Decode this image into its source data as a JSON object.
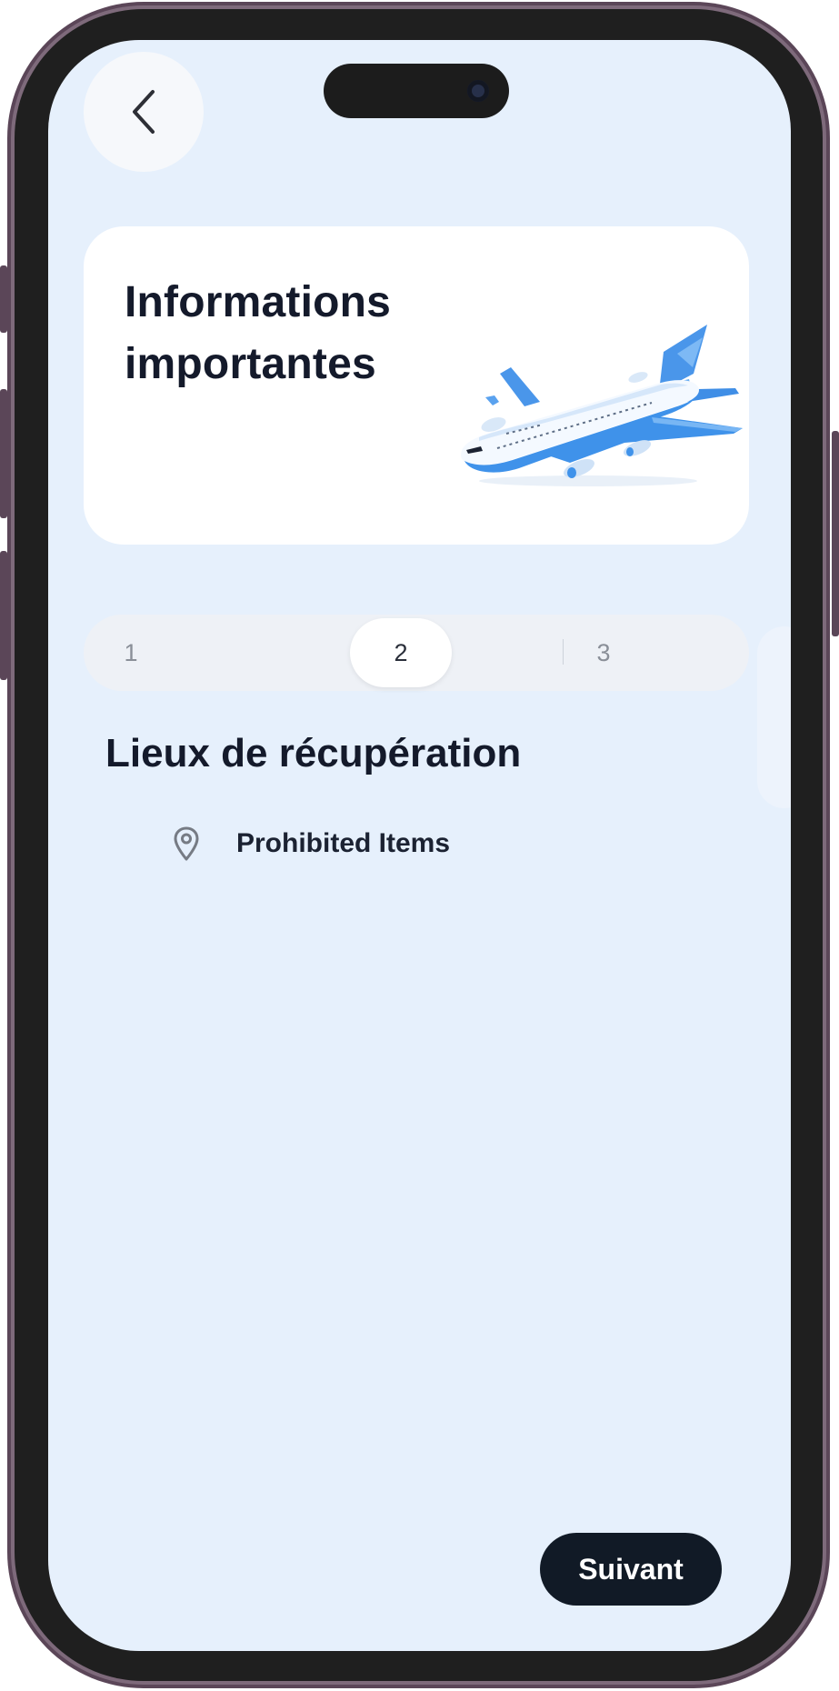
{
  "header": {
    "title": "Informations importantes"
  },
  "steps": {
    "items": [
      "1",
      "2",
      "3"
    ],
    "selected": "2"
  },
  "section": {
    "title": "Lieux de récupération"
  },
  "locations": [
    {
      "label": "Prohibited Items",
      "icon": "location-pin-icon"
    }
  ],
  "footer": {
    "next_label": "Suivant"
  },
  "icons": {
    "back": "chevron-left-icon",
    "illustration": "airplane-illustration"
  },
  "colors": {
    "screen_bg": "#e6f0fc",
    "card_bg": "#ffffff",
    "primary_dark": "#111a26",
    "plane_blue": "#3f92ea"
  }
}
